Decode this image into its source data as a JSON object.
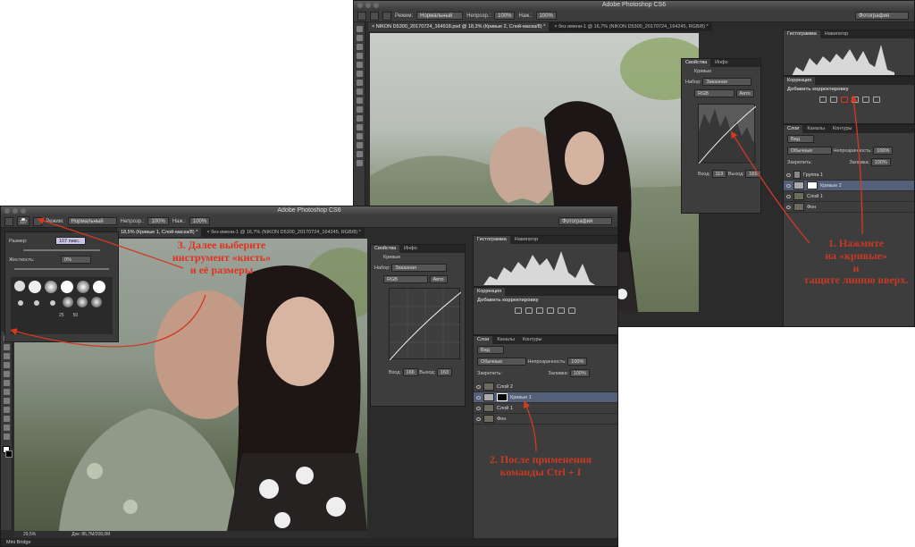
{
  "app_title": "Adobe Photoshop CS6",
  "options": {
    "mode_label": "Режим:",
    "mode_value": "Нормальный",
    "opacity_label": "Непрозр.:",
    "opacity_value": "100%",
    "flow_label": "Наж.:",
    "flow_value": "100%",
    "workspace": "Фотография",
    "brush_size": "107"
  },
  "back_window": {
    "tabs": [
      "× NIKON D5300_20170724_164918.psd @ 18,3% (Кривые 2, Слой-маска/8) *",
      "× без имени-1 @ 16,7% (NIKON D5300_20170724_164245, RGB/8) *"
    ],
    "histogram_tabs": [
      "Гистограмма",
      "Навигатор"
    ],
    "correction_title": "Коррекция",
    "correction_hint": "Добавить корректировку",
    "layers_tabs": [
      "Слои",
      "Каналы",
      "Контуры"
    ],
    "layer_kind": "Вид",
    "blend_mode": "Обычные",
    "opacity_label": "Непрозрачность:",
    "opacity_value": "100%",
    "lock_label": "Закрепить:",
    "fill_label": "Заливка:",
    "fill_value": "100%",
    "layers": [
      {
        "name": "Группа 1",
        "selected": false
      },
      {
        "name": "Кривые 2",
        "selected": true
      },
      {
        "name": "Слой 1",
        "selected": false
      },
      {
        "name": "Фон",
        "selected": false
      }
    ],
    "props_tabs": [
      "Свойства",
      "Инфо"
    ],
    "props_title": "Кривые",
    "preset_label": "Набор:",
    "preset_value": "Заказная",
    "channel_value": "RGB",
    "auto_label": "Авто",
    "input_label": "Вход:",
    "input_value": "119",
    "output_label": "Выход:",
    "output_value": "165"
  },
  "front_window": {
    "tabs": [
      "18,5% (Кривые 1, Слой-маска/8) *",
      "× без имени-1 @ 16,7% (NIKON D5300_20170724_164245, RGB/8) *"
    ],
    "props_tabs": [
      "Свойства",
      "Инфо"
    ],
    "props_title": "Кривые",
    "preset_label": "Набор:",
    "preset_value": "Заказная",
    "channel_value": "RGB",
    "auto_label": "Авто",
    "input_label": "Вход:",
    "input_value": "166",
    "output_label": "Выход:",
    "output_value": "163",
    "histogram_tabs": [
      "Гистограмма",
      "Навигатор"
    ],
    "correction_title": "Коррекция",
    "correction_hint": "Добавить корректировку",
    "layers_tabs": [
      "Слои",
      "Каналы",
      "Контуры"
    ],
    "layer_kind": "Вид",
    "blend_mode": "Обычные",
    "opacity_label": "Непрозрачность:",
    "opacity_value": "100%",
    "lock_label": "Закрепить:",
    "fill_label": "Заливка:",
    "fill_value": "100%",
    "layers": [
      {
        "name": "Слой 2",
        "selected": false
      },
      {
        "name": "Кривые 1",
        "selected": true
      },
      {
        "name": "Слой 1",
        "selected": false
      },
      {
        "name": "Фон",
        "selected": false
      }
    ],
    "status_zoom": "29,5%",
    "status_doc": "Док: 86,7M/208,0M",
    "mini_bridge": "Mini Bridge"
  },
  "brush_popup": {
    "size_label": "Размер:",
    "size_value": "107 пикс.",
    "hardness_label": "Жесткость:",
    "hardness_value": "0%",
    "preset_numbers": [
      "25",
      "50"
    ]
  },
  "annotations": {
    "a1": [
      "1. Нажмите",
      "на «кривые»",
      "и",
      "тащите линию вверх."
    ],
    "a2": [
      "2. После применения",
      "команды Ctrl + I"
    ],
    "a3": [
      "3. Далее выберите",
      "инструмент «кисть»",
      "и её размеры"
    ]
  },
  "colors": {
    "annotation": "#c73a24",
    "ui_dark": "#2b2b2b",
    "selected_layer": "#54607a"
  }
}
